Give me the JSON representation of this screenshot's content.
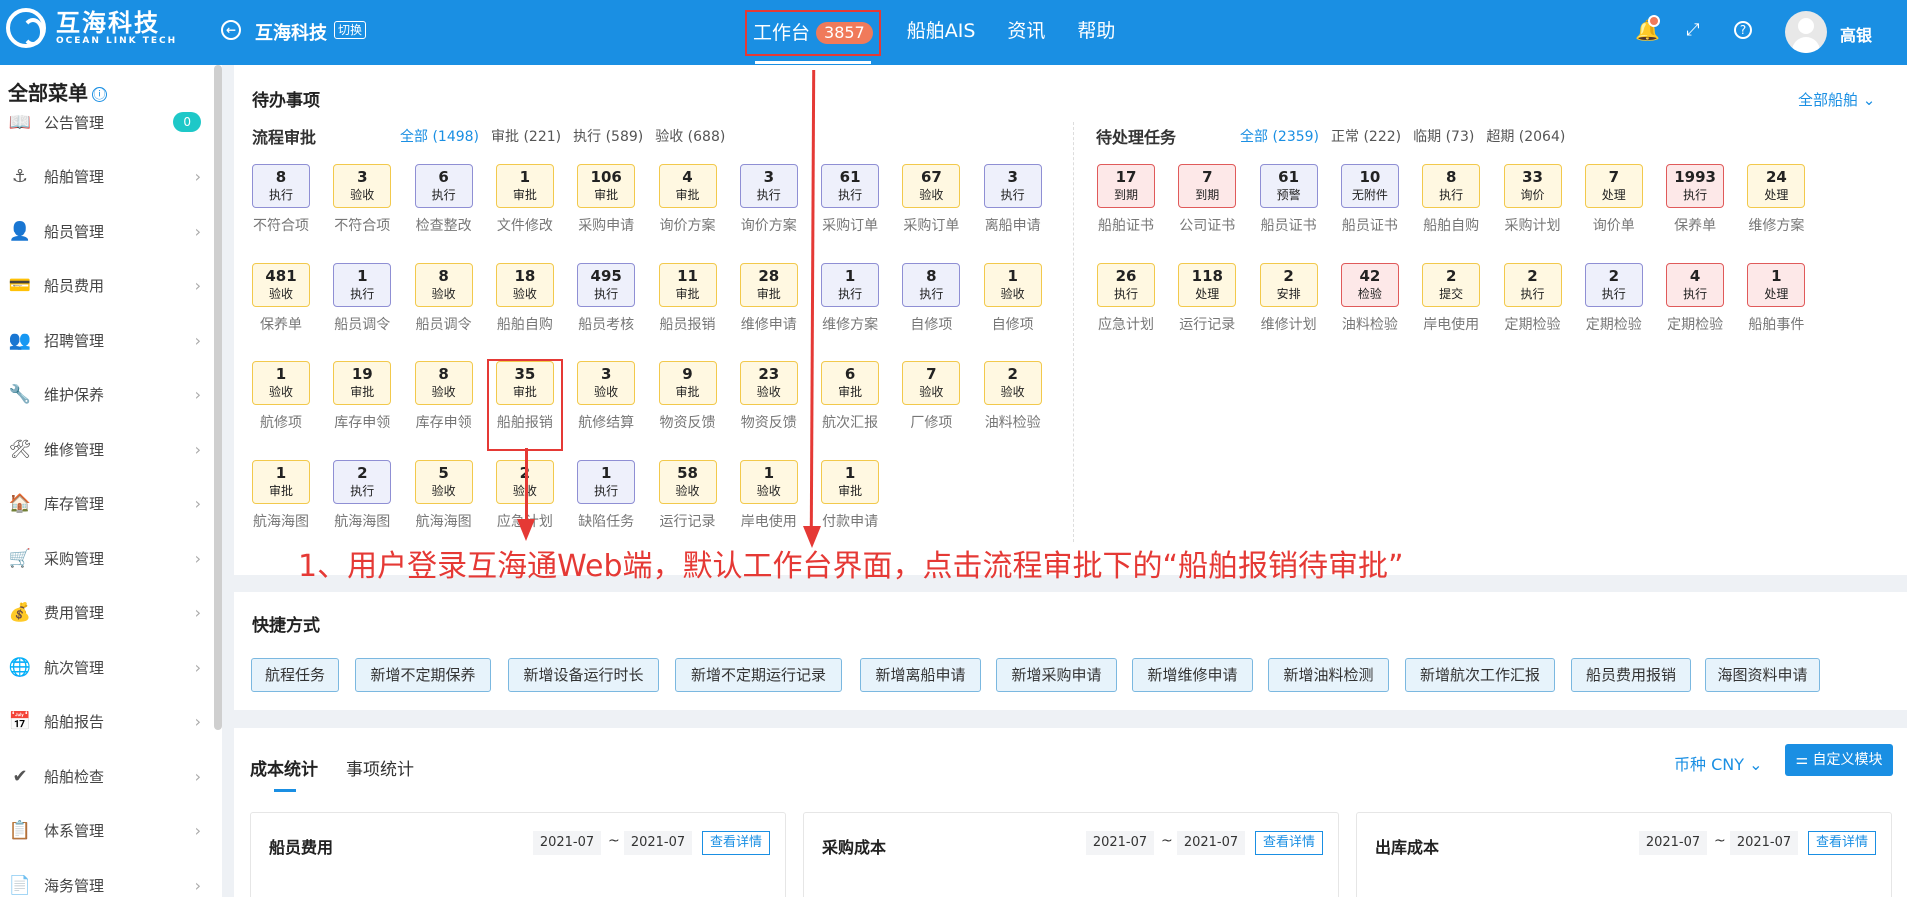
{
  "header": {
    "logo_cn": "互海科技",
    "logo_en": "OCEAN LINK TECH",
    "org_name": "互海科技",
    "switch_label": "切换",
    "nav": [
      {
        "label": "工作台",
        "badge": "3857"
      },
      {
        "label": "船舶AIS"
      },
      {
        "label": "资讯"
      },
      {
        "label": "帮助"
      }
    ],
    "user_name": "高银",
    "icons": [
      "bell-icon",
      "fullscreen-icon",
      "help-icon"
    ]
  },
  "sidebar": {
    "title": "全部菜单",
    "title_icon": "ⓘ",
    "items": [
      {
        "label": "公告管理",
        "icon": "📖",
        "badge": "0"
      },
      {
        "label": "船舶管理",
        "icon": "⚓"
      },
      {
        "label": "船员管理",
        "icon": "👤"
      },
      {
        "label": "船员费用",
        "icon": "💳"
      },
      {
        "label": "招聘管理",
        "icon": "👥"
      },
      {
        "label": "维护保养",
        "icon": "🔧"
      },
      {
        "label": "维修管理",
        "icon": "🛠"
      },
      {
        "label": "库存管理",
        "icon": "🏠"
      },
      {
        "label": "采购管理",
        "icon": "🛒"
      },
      {
        "label": "费用管理",
        "icon": "💰"
      },
      {
        "label": "航次管理",
        "icon": "🌐"
      },
      {
        "label": "船舶报告",
        "icon": "📅"
      },
      {
        "label": "船舶检查",
        "icon": "✔"
      },
      {
        "label": "体系管理",
        "icon": "📋"
      },
      {
        "label": "海务管理",
        "icon": "📄"
      }
    ]
  },
  "todo": {
    "title": "待办事项",
    "all_ships": "全部船舶 ⌄",
    "flow": {
      "title": "流程审批",
      "filters": [
        "全部 (1498)",
        "审批 (221)",
        "执行 (589)",
        "验收 (688)"
      ],
      "tiles": [
        {
          "n": "8",
          "t": "执行",
          "label": "不符合项",
          "c": "purple"
        },
        {
          "n": "3",
          "t": "验收",
          "label": "不符合项",
          "c": "yellow"
        },
        {
          "n": "6",
          "t": "执行",
          "label": "检查整改",
          "c": "purple"
        },
        {
          "n": "1",
          "t": "审批",
          "label": "文件修改",
          "c": "yellow"
        },
        {
          "n": "106",
          "t": "审批",
          "label": "采购申请",
          "c": "yellow"
        },
        {
          "n": "4",
          "t": "审批",
          "label": "询价方案",
          "c": "yellow"
        },
        {
          "n": "3",
          "t": "执行",
          "label": "询价方案",
          "c": "purple"
        },
        {
          "n": "61",
          "t": "执行",
          "label": "采购订单",
          "c": "purple"
        },
        {
          "n": "67",
          "t": "验收",
          "label": "采购订单",
          "c": "yellow"
        },
        {
          "n": "3",
          "t": "执行",
          "label": "离船申请",
          "c": "purple"
        },
        {
          "n": "481",
          "t": "验收",
          "label": "保养单",
          "c": "yellow"
        },
        {
          "n": "1",
          "t": "执行",
          "label": "船员调令",
          "c": "purple"
        },
        {
          "n": "8",
          "t": "验收",
          "label": "船员调令",
          "c": "yellow"
        },
        {
          "n": "18",
          "t": "验收",
          "label": "船舶自购",
          "c": "yellow"
        },
        {
          "n": "495",
          "t": "执行",
          "label": "船员考核",
          "c": "purple"
        },
        {
          "n": "11",
          "t": "审批",
          "label": "船员报销",
          "c": "yellow"
        },
        {
          "n": "28",
          "t": "审批",
          "label": "维修申请",
          "c": "yellow"
        },
        {
          "n": "1",
          "t": "执行",
          "label": "维修方案",
          "c": "purple"
        },
        {
          "n": "8",
          "t": "执行",
          "label": "自修项",
          "c": "purple"
        },
        {
          "n": "1",
          "t": "验收",
          "label": "自修项",
          "c": "yellow"
        },
        {
          "n": "1",
          "t": "验收",
          "label": "航修项",
          "c": "yellow"
        },
        {
          "n": "19",
          "t": "审批",
          "label": "库存申领",
          "c": "yellow"
        },
        {
          "n": "8",
          "t": "验收",
          "label": "库存申领",
          "c": "yellow"
        },
        {
          "n": "35",
          "t": "审批",
          "label": "船舶报销",
          "c": "yellow",
          "highlight": true
        },
        {
          "n": "3",
          "t": "验收",
          "label": "航修结算",
          "c": "yellow"
        },
        {
          "n": "9",
          "t": "审批",
          "label": "物资反馈",
          "c": "yellow"
        },
        {
          "n": "23",
          "t": "验收",
          "label": "物资反馈",
          "c": "yellow"
        },
        {
          "n": "6",
          "t": "审批",
          "label": "航次汇报",
          "c": "yellow"
        },
        {
          "n": "7",
          "t": "验收",
          "label": "厂修项",
          "c": "yellow"
        },
        {
          "n": "2",
          "t": "验收",
          "label": "油料检验",
          "c": "yellow"
        },
        {
          "n": "1",
          "t": "审批",
          "label": "航海海图",
          "c": "yellow"
        },
        {
          "n": "2",
          "t": "执行",
          "label": "航海海图",
          "c": "purple"
        },
        {
          "n": "5",
          "t": "验收",
          "label": "航海海图",
          "c": "yellow"
        },
        {
          "n": "2",
          "t": "验收",
          "label": "应急计划",
          "c": "yellow"
        },
        {
          "n": "1",
          "t": "执行",
          "label": "缺陷任务",
          "c": "purple"
        },
        {
          "n": "58",
          "t": "验收",
          "label": "运行记录",
          "c": "yellow"
        },
        {
          "n": "1",
          "t": "验收",
          "label": "岸电使用",
          "c": "yellow"
        },
        {
          "n": "1",
          "t": "审批",
          "label": "付款申请",
          "c": "yellow"
        }
      ]
    },
    "pending": {
      "title": "待处理任务",
      "filters": [
        "全部 (2359)",
        "正常 (222)",
        "临期 (73)",
        "超期 (2064)"
      ],
      "tiles": [
        {
          "n": "17",
          "t": "到期",
          "label": "船舶证书",
          "c": "red"
        },
        {
          "n": "7",
          "t": "到期",
          "label": "公司证书",
          "c": "red"
        },
        {
          "n": "61",
          "t": "预警",
          "label": "船员证书",
          "c": "purple"
        },
        {
          "n": "10",
          "t": "无附件",
          "label": "船员证书",
          "c": "purple"
        },
        {
          "n": "8",
          "t": "执行",
          "label": "船舶自购",
          "c": "yellow"
        },
        {
          "n": "33",
          "t": "询价",
          "label": "采购计划",
          "c": "yellow"
        },
        {
          "n": "7",
          "t": "处理",
          "label": "询价单",
          "c": "yellow"
        },
        {
          "n": "1993",
          "t": "执行",
          "label": "保养单",
          "c": "red"
        },
        {
          "n": "24",
          "t": "处理",
          "label": "维修方案",
          "c": "yellow"
        },
        {
          "n": "26",
          "t": "执行",
          "label": "应急计划",
          "c": "yellow"
        },
        {
          "n": "118",
          "t": "处理",
          "label": "运行记录",
          "c": "yellow"
        },
        {
          "n": "2",
          "t": "安排",
          "label": "维修计划",
          "c": "yellow"
        },
        {
          "n": "42",
          "t": "检验",
          "label": "油料检验",
          "c": "red"
        },
        {
          "n": "2",
          "t": "提交",
          "label": "岸电使用",
          "c": "yellow"
        },
        {
          "n": "2",
          "t": "执行",
          "label": "定期检验",
          "c": "yellow"
        },
        {
          "n": "2",
          "t": "执行",
          "label": "定期检验",
          "c": "purple"
        },
        {
          "n": "4",
          "t": "执行",
          "label": "定期检验",
          "c": "red"
        },
        {
          "n": "1",
          "t": "处理",
          "label": "船舶事件",
          "c": "red"
        }
      ]
    }
  },
  "annotation": "1、用户登录互海通Web端，默认工作台界面，点击流程审批下的“船舶报销待审批”",
  "shortcuts": {
    "title": "快捷方式",
    "items": [
      "航程任务",
      "新增不定期保养",
      "新增设备运行时长",
      "新增不定期运行记录",
      "新增离船申请",
      "新增采购申请",
      "新增维修申请",
      "新增油料检测",
      "新增航次工作汇报",
      "船员费用报销",
      "海图资料申请"
    ]
  },
  "stats": {
    "tabs": [
      "成本统计",
      "事项统计"
    ],
    "currency": "币种 CNY ⌄",
    "custom_button": "⚌ 自定义模块",
    "cards": [
      {
        "title": "船员费用",
        "from": "2021-07",
        "to": "2021-07",
        "detail": "查看详情"
      },
      {
        "title": "采购成本",
        "from": "2021-07",
        "to": "2021-07",
        "detail": "查看详情"
      },
      {
        "title": "出库成本",
        "from": "2021-07",
        "to": "2021-07",
        "detail": "查看详情"
      }
    ]
  },
  "colors": {
    "brand": "#1a8fe3",
    "annotation": "#e53935",
    "badge": "#f07a5a"
  }
}
